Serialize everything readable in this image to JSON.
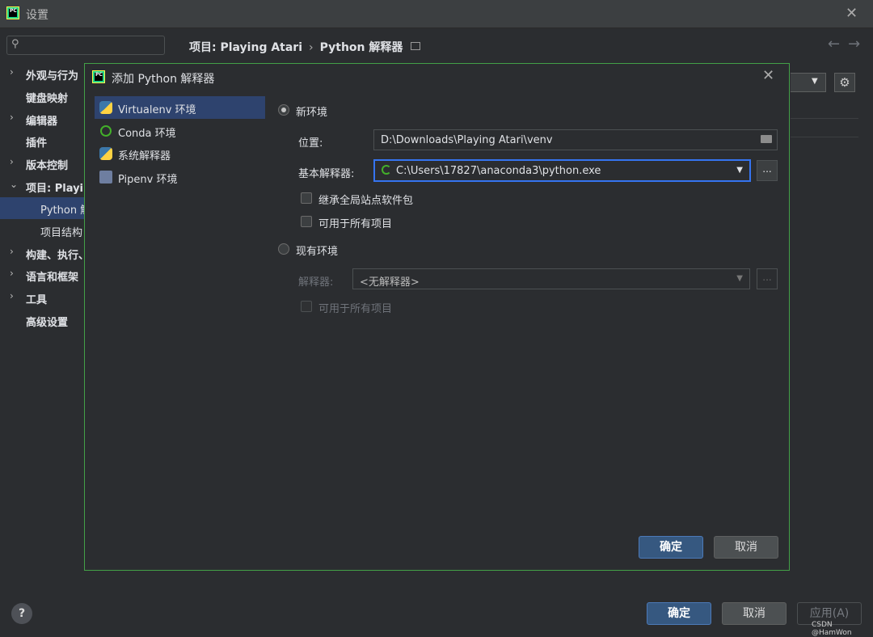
{
  "window": {
    "title": "设置"
  },
  "breadcrumb": {
    "project": "项目: Playing Atari",
    "page": "Python 解释器"
  },
  "search": {
    "placeholder": ""
  },
  "sidebar": {
    "items": [
      {
        "label": "外观与行为",
        "chev": "›"
      },
      {
        "label": "键盘映射",
        "chev": ""
      },
      {
        "label": "编辑器",
        "chev": "›"
      },
      {
        "label": "插件",
        "chev": ""
      },
      {
        "label": "版本控制",
        "chev": "›"
      },
      {
        "label": "项目: Playing Atari",
        "chev": "⌄"
      },
      {
        "label": "Python 解释器",
        "chev": ""
      },
      {
        "label": "项目结构",
        "chev": ""
      },
      {
        "label": "构建、执行、部署",
        "chev": "›"
      },
      {
        "label": "语言和框架",
        "chev": "›"
      },
      {
        "label": "工具",
        "chev": "›"
      },
      {
        "label": "高级设置",
        "chev": ""
      }
    ]
  },
  "dialog": {
    "title": "添加 Python 解释器",
    "env_types": [
      {
        "label": "Virtualenv 环境",
        "icon": "python-icon"
      },
      {
        "label": "Conda 环境",
        "icon": "conda-icon"
      },
      {
        "label": "系统解释器",
        "icon": "python-icon"
      },
      {
        "label": "Pipenv 环境",
        "icon": "pipenv-icon"
      }
    ],
    "new_env": {
      "label": "新环境",
      "location_label": "位置:",
      "location_value": "D:\\Downloads\\Playing Atari\\venv",
      "base_label": "基本解释器:",
      "base_value": "C:\\Users\\17827\\anaconda3\\python.exe",
      "ellipsis": "...",
      "inherit_label": "继承全局站点软件包",
      "all_projects_label": "可用于所有项目"
    },
    "existing_env": {
      "label": "现有环境",
      "interpreter_label": "解释器:",
      "interpreter_value": "<无解释器>",
      "ellipsis": "...",
      "all_projects_label": "可用于所有项目"
    },
    "ok_label": "确定",
    "cancel_label": "取消"
  },
  "footer": {
    "help": "?",
    "ok_label": "确定",
    "cancel_label": "取消",
    "apply_label": "应用(A)"
  },
  "watermark": "CSDN @HamWon",
  "colors": {
    "accent": "#365880",
    "selection": "#2e436e",
    "dialog_border": "#43a047",
    "focus": "#3574f0"
  }
}
